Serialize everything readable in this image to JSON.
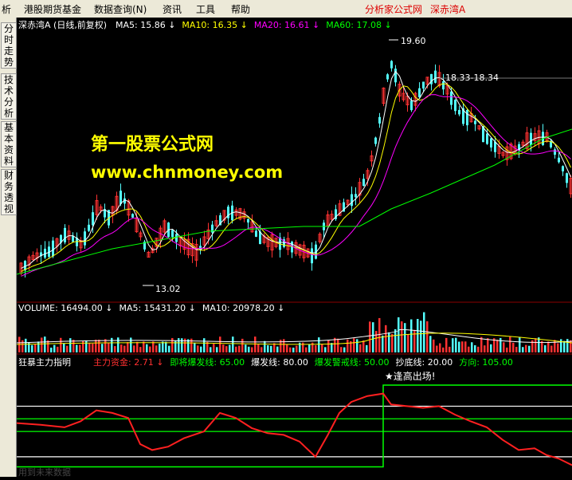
{
  "menu": {
    "items": [
      "析",
      "港股期货基金",
      "数据查询(N)",
      "资讯",
      "工具",
      "帮助"
    ],
    "links": [
      "分析家公式网",
      "深赤湾A"
    ]
  },
  "sidebar": {
    "tabs": [
      "分时走势",
      "技术分析",
      "基本资料",
      "财务透视"
    ]
  },
  "price_panel": {
    "title": "深赤湾A (日线,前复权)",
    "indicators": [
      {
        "label": "MA5:",
        "value": "15.86",
        "arrow": "↓",
        "color": "#ffffff"
      },
      {
        "label": "MA10:",
        "value": "16.35",
        "arrow": "↓",
        "color": "#ffff00"
      },
      {
        "label": "MA20:",
        "value": "16.61",
        "arrow": "↓",
        "color": "#ff00ff"
      },
      {
        "label": "MA60:",
        "value": "17.08",
        "arrow": "↓",
        "color": "#00ff00"
      }
    ],
    "high_label": "19.60",
    "low_label": "13.02",
    "range_label": "18.33-18.34"
  },
  "volume_panel": {
    "indicators": [
      {
        "label": "VOLUME:",
        "value": "16494.00",
        "arrow": "↓",
        "color": "#ffffff"
      },
      {
        "label": "MA5:",
        "value": "15431.20",
        "arrow": "↓",
        "color": "#ffffff"
      },
      {
        "label": "MA10:",
        "value": "20978.20",
        "arrow": "↓",
        "color": "#ffffff"
      }
    ]
  },
  "indicator_panel": {
    "name": "狂暴主力指明",
    "items": [
      {
        "label": "主力资金:",
        "value": "2.71",
        "arrow": "↓",
        "color": "#ff3030"
      },
      {
        "label": "即将爆发线:",
        "value": "65.00",
        "arrow": "",
        "color": "#00ff00"
      },
      {
        "label": "爆发线:",
        "value": "80.00",
        "arrow": "",
        "color": "#ffffff"
      },
      {
        "label": "爆发警戒线:",
        "value": "50.00",
        "arrow": "",
        "color": "#00ff00"
      },
      {
        "label": "抄底线:",
        "value": "20.00",
        "arrow": "",
        "color": "#ffffff"
      },
      {
        "label": "方向:",
        "value": "105.00",
        "arrow": "",
        "color": "#00ff00"
      }
    ],
    "signal_text": "★逢高出场!",
    "bottom_text": "用到未来数据"
  },
  "watermark": {
    "line1": "第一股票公式网",
    "line2": "www.chnmoney.com"
  },
  "colors": {
    "up": "#ff3232",
    "down": "#54ffff",
    "ma5": "#ffffff",
    "ma10": "#ffff00",
    "ma20": "#ff00ff",
    "ma60": "#00ff00",
    "grid": "#8b0000"
  }
}
